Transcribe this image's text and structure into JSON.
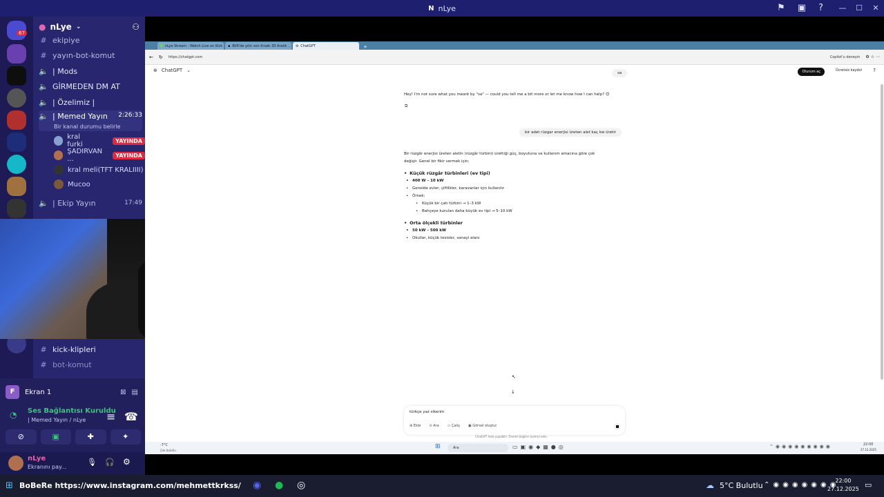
{
  "window": {
    "title": "nLye"
  },
  "server": {
    "name": "nLye",
    "badge": "67"
  },
  "channels": [
    {
      "icon": "#",
      "label": "ekipiye"
    },
    {
      "icon": "#",
      "label": "yayın-bot-komut"
    },
    {
      "icon": "speaker",
      "label": "| Mods"
    },
    {
      "icon": "speaker",
      "label": "GİRMEDEN DM AT"
    },
    {
      "icon": "speaker",
      "label": "| Özelimiz |"
    },
    {
      "icon": "speaker",
      "label": "| Memed Yayın",
      "time": "2:26:33",
      "status": "Bir kanal durumu belirle"
    }
  ],
  "voice_users": [
    {
      "name": "kral furki",
      "live": "YAYINDA"
    },
    {
      "name": "ŞADIRVAN ...",
      "live": "YAYINDA"
    },
    {
      "name": "kral meli(TFT KRALIIII)"
    },
    {
      "name": "Mucoo"
    }
  ],
  "ekip_channel": {
    "label": "| Ekip Yayın",
    "time": "17:49"
  },
  "lower_channels": [
    {
      "label": "kick-klipleri"
    },
    {
      "label": "bot-komut"
    }
  ],
  "screen_share": {
    "label": "Ekran 1",
    "letter": "F"
  },
  "voice_connection": {
    "status": "Ses Bağlantısı Kuruldu",
    "channel": "| Memed Yayın / nLye"
  },
  "user": {
    "name": "nLye",
    "status": "Ekranını pay..."
  },
  "browser": {
    "tabs": [
      {
        "label": "nLye Stream - Watch Live on Kick"
      },
      {
        "label": "Bilfi'de yılın son fırsatı 30 Aralık ..."
      },
      {
        "label": "ChatGPT",
        "active": true
      }
    ],
    "url": "https://chatgpt.com",
    "copilot": "Copilot'u deneyin"
  },
  "chat": {
    "app_name": "ChatGPT",
    "login": "Oturum aç",
    "signup": "Ücretsiz kaydol",
    "user_msg_1": "sa",
    "assistant_msg_1": "Hey! I'm not sure what you meant by \"sa\" — could you tell me a bit more or let me know how I can help? 😊",
    "user_msg_2": "bir adet rüzgar enerjisi üreten alet kaç kw üretir",
    "answer_intro_1": "Bir rüzgâr enerjisi üreten aletin (rüzgâr türbini) ürettiği güç, boyutuna ve kullanım amacına göre çok",
    "answer_intro_2": "değişir. Genel bir fikir vermek için:",
    "section_1_title": "Küçük rüzgâr türbinleri (ev tipi)",
    "section_1_items": [
      "400 W – 10 kW",
      "Genelde evler, çiftlikler, karavanlar için kullanılır",
      "Örnek:"
    ],
    "section_1_sub": [
      "Küçük bir çatı türbini → 1–3 kW",
      "Bahçeye kurulan daha büyük ev tipi → 5–10 kW"
    ],
    "section_2_title": "Orta ölçekli türbinler",
    "section_2_items": [
      "50 kW – 500 kW",
      "Okullar, küçük tesisler, sanayi alanı"
    ],
    "composer_text": "türkçe yaz sikerim",
    "composer_buttons": [
      "Ekle",
      "Ara",
      "Çalış",
      "Görsel oluştur"
    ],
    "disclaimer": "ChatGPT hata yapabilir. Önemli bilgileri kontrol edin."
  },
  "inner_taskbar": {
    "weather": "-7°C",
    "weather_sub": "Çok bulutlu",
    "search": "Ara",
    "time": "22:00",
    "date": "27.12.2025"
  },
  "outer_taskbar": {
    "ticker": "BoBeRe  https://www.instagram.com/mehmettkrkss/",
    "weather": "5°C  Bulutlu",
    "time": "22:00",
    "date": "27.12.2025"
  },
  "colors": {
    "discord_bg": "#27266e",
    "rail_bg": "#1d1a55",
    "live_red": "#e0283f",
    "browser_tabbar": "#4c7fa4"
  }
}
